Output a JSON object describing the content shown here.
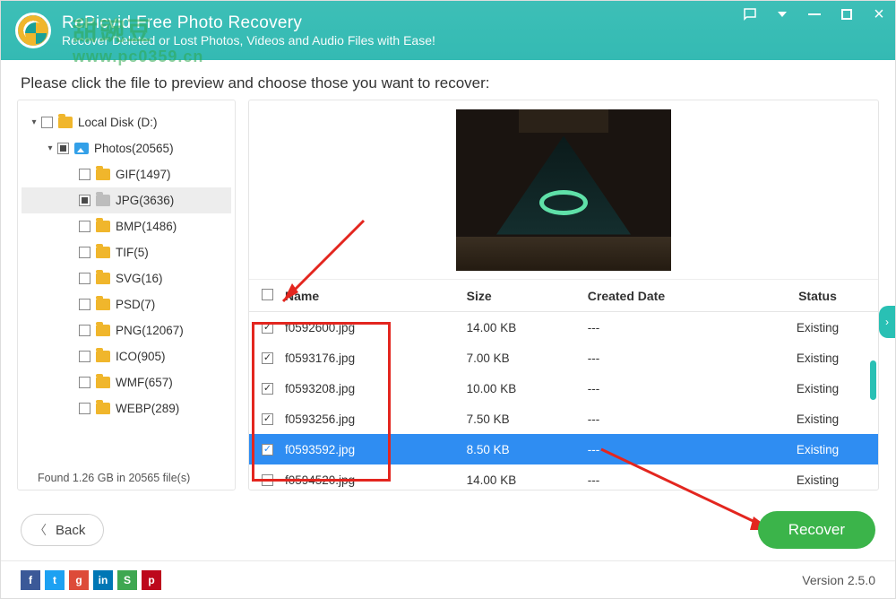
{
  "header": {
    "title": "RePicvid Free Photo Recovery",
    "subtitle": "Recover Deleted or Lost Photos, Videos and Audio Files with Ease!"
  },
  "watermark": {
    "line1": "甜豌豆",
    "line2": "www.pc0359.cn"
  },
  "instruction": "Please click the file to preview and choose those you want to recover:",
  "sidebar": {
    "items": [
      {
        "label": "Local Disk (D:)",
        "icon": "folder",
        "level": 0,
        "check": "empty",
        "toggle": "▾"
      },
      {
        "label": "Photos(20565)",
        "icon": "pic",
        "level": 1,
        "check": "indet",
        "toggle": "▾"
      },
      {
        "label": "GIF(1497)",
        "icon": "folder",
        "level": 2,
        "check": "empty"
      },
      {
        "label": "JPG(3636)",
        "icon": "folder-grey",
        "level": 2,
        "check": "indet",
        "selected": true
      },
      {
        "label": "BMP(1486)",
        "icon": "folder",
        "level": 2,
        "check": "empty"
      },
      {
        "label": "TIF(5)",
        "icon": "folder",
        "level": 2,
        "check": "empty"
      },
      {
        "label": "SVG(16)",
        "icon": "folder",
        "level": 2,
        "check": "empty"
      },
      {
        "label": "PSD(7)",
        "icon": "folder",
        "level": 2,
        "check": "empty"
      },
      {
        "label": "PNG(12067)",
        "icon": "folder",
        "level": 2,
        "check": "empty"
      },
      {
        "label": "ICO(905)",
        "icon": "folder",
        "level": 2,
        "check": "empty"
      },
      {
        "label": "WMF(657)",
        "icon": "folder",
        "level": 2,
        "check": "empty"
      },
      {
        "label": "WEBP(289)",
        "icon": "folder",
        "level": 2,
        "check": "empty"
      }
    ],
    "found": "Found 1.26 GB in 20565 file(s)"
  },
  "columns": {
    "name": "Name",
    "size": "Size",
    "date": "Created Date",
    "status": "Status"
  },
  "files": [
    {
      "name": "f0592600.jpg",
      "size": "14.00 KB",
      "date": "---",
      "status": "Existing",
      "checked": true
    },
    {
      "name": "f0593176.jpg",
      "size": "7.00 KB",
      "date": "---",
      "status": "Existing",
      "checked": true
    },
    {
      "name": "f0593208.jpg",
      "size": "10.00 KB",
      "date": "---",
      "status": "Existing",
      "checked": true
    },
    {
      "name": "f0593256.jpg",
      "size": "7.50 KB",
      "date": "---",
      "status": "Existing",
      "checked": true
    },
    {
      "name": "f0593592.jpg",
      "size": "8.50 KB",
      "date": "---",
      "status": "Existing",
      "checked": true,
      "selected": true
    },
    {
      "name": "f0594520.jpg",
      "size": "14.00 KB",
      "date": "---",
      "status": "Existing",
      "checked": false
    }
  ],
  "buttons": {
    "back": "Back",
    "recover": "Recover"
  },
  "version": "Version 2.5.0",
  "social": [
    {
      "bg": "#3b5998",
      "txt": "f"
    },
    {
      "bg": "#1da1f2",
      "txt": "t"
    },
    {
      "bg": "#dd4b39",
      "txt": "g"
    },
    {
      "bg": "#0077b5",
      "txt": "in"
    },
    {
      "bg": "#3ea751",
      "txt": "S"
    },
    {
      "bg": "#bd081c",
      "txt": "p"
    }
  ]
}
